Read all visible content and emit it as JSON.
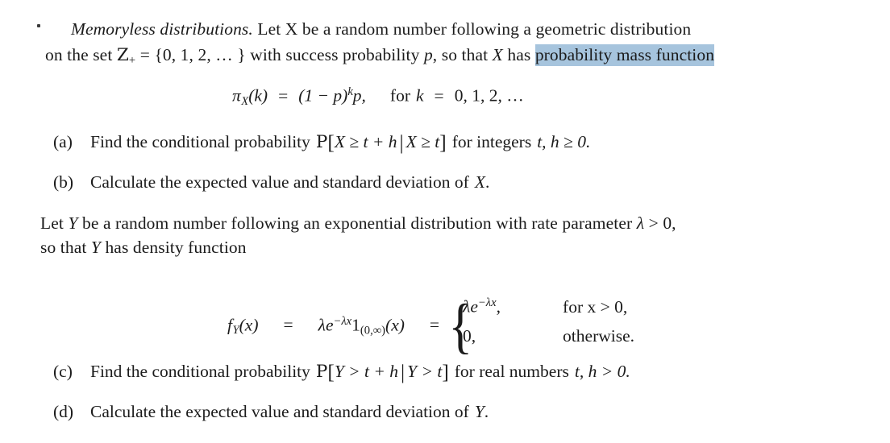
{
  "document": {
    "type": "math-exercise",
    "title_runin": "Memoryless distributions.",
    "paragraph1": {
      "line1_after_title": " Let  X  be a random number following a geometric distribution",
      "line2_prefix": "on the set ",
      "set_symbol": "Z",
      "set_subscript": "+",
      "set_equals": " = ",
      "set_value": "{0, 1, 2, … }",
      "line2_mid": " with success probability ",
      "success_param": "p",
      "line2_tail": ", so that ",
      "random_var": "X",
      "line2_has": " has ",
      "highlighted_text": "probability mass function"
    },
    "equation_pmf": {
      "lhs_fn": "π",
      "lhs_sub": "X",
      "lhs_arg": "(k)",
      "equals": "=",
      "rhs_base": "(1 − p)",
      "rhs_exp": "k",
      "rhs_tail": "p,",
      "condition_for": "for",
      "condition_var": "k",
      "condition_equals": "=",
      "condition_values": "0, 1, 2, …"
    },
    "items_first": [
      {
        "label": "(a)",
        "text_before": "Find the conditional probability",
        "prob_symbol": "P",
        "event_main": "X ≥ t + h",
        "event_given": "X ≥ t",
        "text_after": "for integers",
        "domain_text": "t, h ≥ 0."
      },
      {
        "label": "(b)",
        "text": "Calculate the expected value and standard deviation of",
        "variable": "X",
        "period": "."
      }
    ],
    "paragraph2": {
      "line1_a": "Let ",
      "var_y": "Y",
      "line1_b": " be a random number following an exponential distribution with rate parameter ",
      "rate_param": "λ",
      "rate_condition": " > 0,",
      "line2_a": "so that ",
      "line2_b": " has density function"
    },
    "equation_density": {
      "lhs_fn": "f",
      "lhs_sub": "Y",
      "lhs_arg": "(x)",
      "equals1": "=",
      "rhs_lambda": "λ",
      "rhs_e": "e",
      "rhs_exp": "−λx",
      "indicator_one": "1",
      "indicator_sub": "(0,∞)",
      "indicator_arg": "(x)",
      "equals2": "=",
      "cases": [
        {
          "value_lambda": "λ",
          "value_e": "e",
          "value_exp": "−λx",
          "value_tail": ",",
          "condition": "for x > 0,"
        },
        {
          "value_lambda": "",
          "value_e": "",
          "value_exp": "",
          "value_tail": "0,",
          "condition": "otherwise."
        }
      ]
    },
    "items_second": [
      {
        "label": "(c)",
        "text_before": "Find the conditional probability",
        "prob_symbol": "P",
        "event_main": "Y > t + h",
        "event_given": "Y > t",
        "text_after": "for real numbers",
        "domain_text": "t, h > 0."
      },
      {
        "label": "(d)",
        "text": "Calculate the expected value and standard deviation of",
        "variable": "Y",
        "period": "."
      }
    ],
    "colors": {
      "page_background": "#ffffff",
      "text": "#1b1b1b",
      "selection_highlight": "#a6c4dd"
    }
  }
}
